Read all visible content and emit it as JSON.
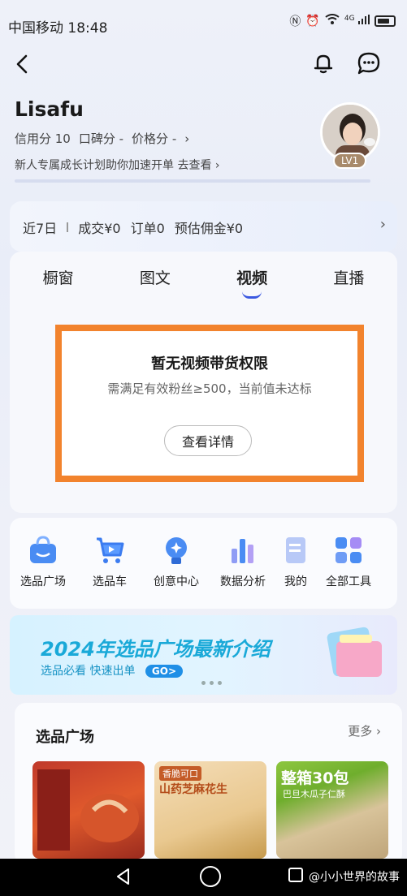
{
  "status_bar": {
    "carrier_time": "中国移动 18:48",
    "icons": [
      "nfc-icon",
      "alarm-icon",
      "wifi-icon",
      "signal-4g-icon",
      "battery-icon"
    ],
    "network": "4G"
  },
  "nav": {
    "back_icon": "back-arrow-icon",
    "bell_icon": "bell-icon",
    "chat_icon": "chat-bubble-icon"
  },
  "profile": {
    "name": "Lisafu",
    "credit": "信用分 10",
    "reputation": "口碑分 -",
    "price": "价格分 -",
    "scores_chevron": "›",
    "tip": "新人专属成长计划助你加速开单 去查看 ›",
    "level": "LV1"
  },
  "stats": {
    "period": "近7日",
    "deal": "成交¥0",
    "orders": "订单0",
    "commission": "预估佣金¥0",
    "chevron": "›"
  },
  "tabs": [
    {
      "label": "橱窗",
      "active": false
    },
    {
      "label": "图文",
      "active": false
    },
    {
      "label": "视频",
      "active": true
    },
    {
      "label": "直播",
      "active": false
    }
  ],
  "empty_state": {
    "title": "暂无视频带货权限",
    "desc": "需满足有效粉丝≥500，当前值未达标",
    "button": "查看详情"
  },
  "tools": [
    {
      "label": "选品广场",
      "icon": "shopping-bag-icon"
    },
    {
      "label": "选品车",
      "icon": "cart-icon"
    },
    {
      "label": "创意中心",
      "icon": "lightbulb-icon"
    },
    {
      "label": "数据分析",
      "icon": "bar-chart-icon"
    },
    {
      "label": "我的",
      "icon": "document-icon"
    },
    {
      "label": "全部工具",
      "icon": "grid-icon"
    }
  ],
  "banner": {
    "title": "2024年选品广场最新介绍",
    "sub": "选品必看 快速出单",
    "go": "GO>"
  },
  "picks": {
    "title": "选品广场",
    "more": "更多 ›",
    "products": [
      {
        "tag": "",
        "name": ""
      },
      {
        "tag": "香脆可口",
        "name": "山药芝麻花生"
      },
      {
        "big": "整箱30包",
        "small": "巴旦木瓜子仁酥"
      }
    ]
  },
  "system_nav": {
    "watermark": "@小小世界的故事"
  },
  "colors": {
    "accent": "#3a58e0",
    "highlight_border": "#f2832d",
    "banner_text": "#1aa9d8"
  }
}
